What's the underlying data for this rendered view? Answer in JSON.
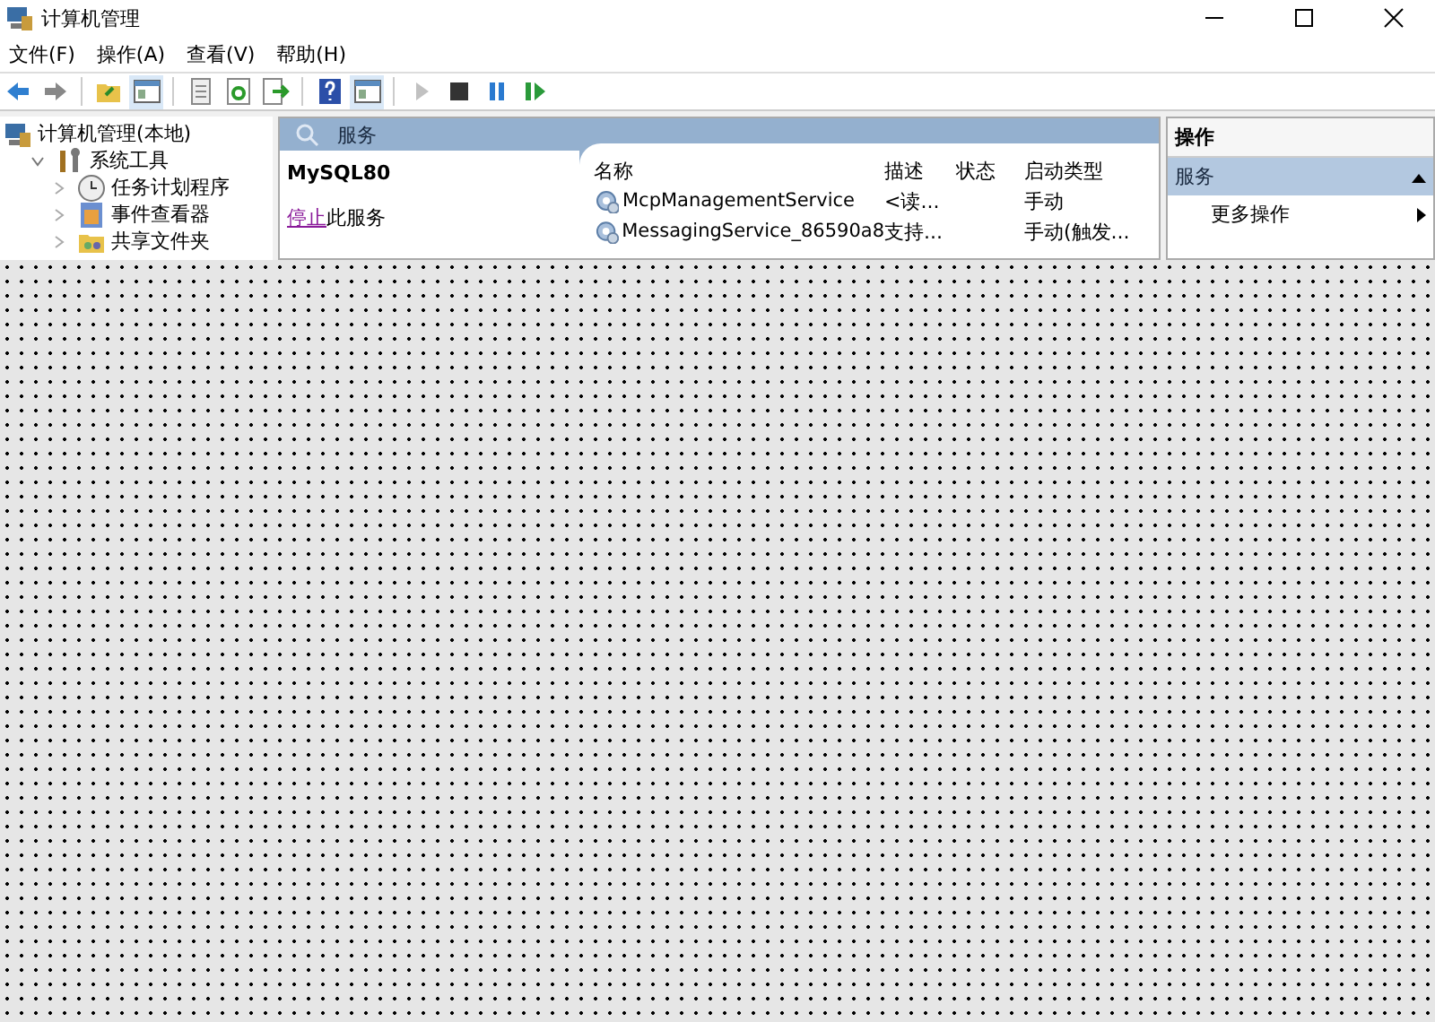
{
  "window": {
    "title": "计算机管理"
  },
  "menu": [
    "文件(F)",
    "操作(A)",
    "查看(V)",
    "帮助(H)"
  ],
  "toolbar": [
    {
      "kind": "back",
      "disabled": false
    },
    {
      "kind": "forward",
      "disabled": false
    },
    {
      "kind": "sep"
    },
    {
      "kind": "folder",
      "disabled": false
    },
    {
      "kind": "console",
      "disabled": false,
      "selected": true
    },
    {
      "kind": "sep"
    },
    {
      "kind": "properties",
      "disabled": false
    },
    {
      "kind": "refresh",
      "disabled": false
    },
    {
      "kind": "export",
      "disabled": false
    },
    {
      "kind": "sep"
    },
    {
      "kind": "help",
      "disabled": false
    },
    {
      "kind": "console",
      "disabled": false,
      "selected": true
    },
    {
      "kind": "sep"
    },
    {
      "kind": "play",
      "disabled": true
    },
    {
      "kind": "stop",
      "disabled": false
    },
    {
      "kind": "pause",
      "disabled": false
    },
    {
      "kind": "resume",
      "disabled": false
    }
  ],
  "tree": [
    {
      "label": "计算机管理(本地)",
      "kind": "computer",
      "expanded": true,
      "children": [
        {
          "label": "系统工具",
          "kind": "tools",
          "expanded": true,
          "children": [
            {
              "label": "任务计划程序",
              "kind": "clock",
              "expanded": false
            },
            {
              "label": "事件查看器",
              "kind": "viewer",
              "expanded": false
            },
            {
              "label": "共享文件夹",
              "kind": "share",
              "expanded": false
            }
          ]
        }
      ]
    }
  ],
  "services_panel": {
    "title": "服务",
    "service_name": "MySQL80",
    "action_link": "停止",
    "action_text": "此服务",
    "columns": [
      "名称",
      "描述",
      "状态",
      "启动类型"
    ],
    "rows": [
      {
        "name": "McpManagementService",
        "description": "<读...",
        "status": "",
        "startup": "手动"
      },
      {
        "name": "MessagingService_86590a8",
        "description": "支持...",
        "status": "",
        "startup": "手动(触发..."
      }
    ]
  },
  "actions": {
    "title": "操作",
    "sections": [
      {
        "label": "服务",
        "expanded": true,
        "items": [
          "更多操作"
        ]
      }
    ]
  }
}
